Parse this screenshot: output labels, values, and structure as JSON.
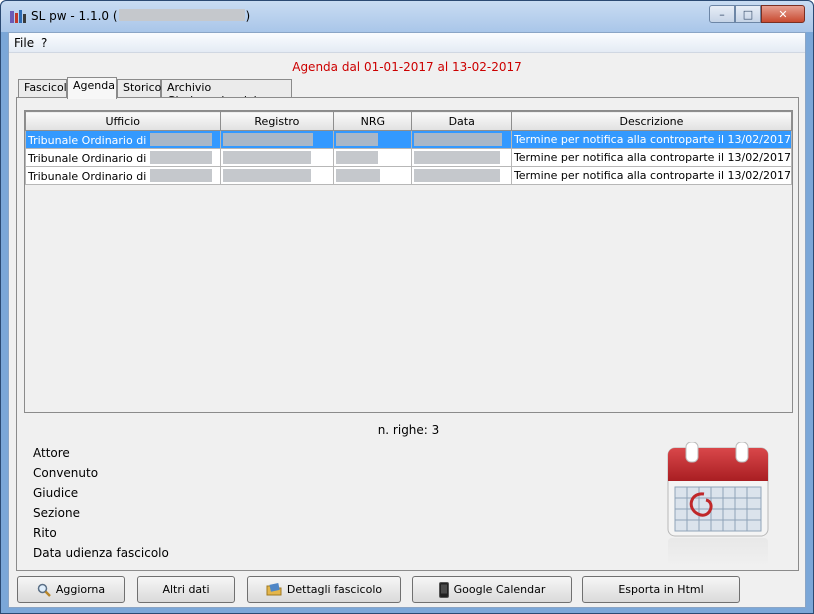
{
  "window": {
    "title_prefix": "SL pw - 1.1.0 (",
    "title_suffix": ")",
    "controls": {
      "minimize": "–",
      "maximize": "□",
      "close": "✕"
    }
  },
  "menu": {
    "file": "File",
    "help": "?"
  },
  "agenda_title": "Agenda dal 01-01-2017 al 13-02-2017",
  "tabs": [
    "Fascicoli",
    "Agenda",
    "Storico",
    "Archivio Giurisprudenziale"
  ],
  "active_tab": "Agenda",
  "table": {
    "columns": [
      "Ufficio",
      "Registro",
      "NRG",
      "Data",
      "Descrizione"
    ],
    "rows": [
      {
        "ufficio": "Tribunale Ordinario di",
        "descrizione": "Termine per notifica alla controparte il 13/02/2017",
        "selected": true
      },
      {
        "ufficio": "Tribunale Ordinario di",
        "descrizione": "Termine per notifica alla controparte il 13/02/2017",
        "selected": false
      },
      {
        "ufficio": "Tribunale Ordinario di",
        "descrizione": "Termine per notifica alla controparte il 13/02/2017",
        "selected": false
      }
    ]
  },
  "row_count_label": "n. righe: 3",
  "details": [
    "Attore",
    "Convenuto",
    "Giudice",
    "Sezione",
    "Rito",
    "Data udienza fascicolo"
  ],
  "buttons": {
    "refresh": "Aggiorna",
    "more_data": "Altri dati",
    "case_details": "Dettagli fascicolo",
    "google_calendar": "Google Calendar",
    "export_html": "Esporta in Html"
  },
  "icons": {
    "app": "app-icon",
    "refresh": "magnifier-icon",
    "case_details": "folder-icon",
    "google_calendar": "phone-icon",
    "calendar_graphic": "calendar-icon"
  },
  "colors": {
    "selection": "#3399ff",
    "title_red": "#cc0000",
    "calendar_red": "#c0282a"
  }
}
